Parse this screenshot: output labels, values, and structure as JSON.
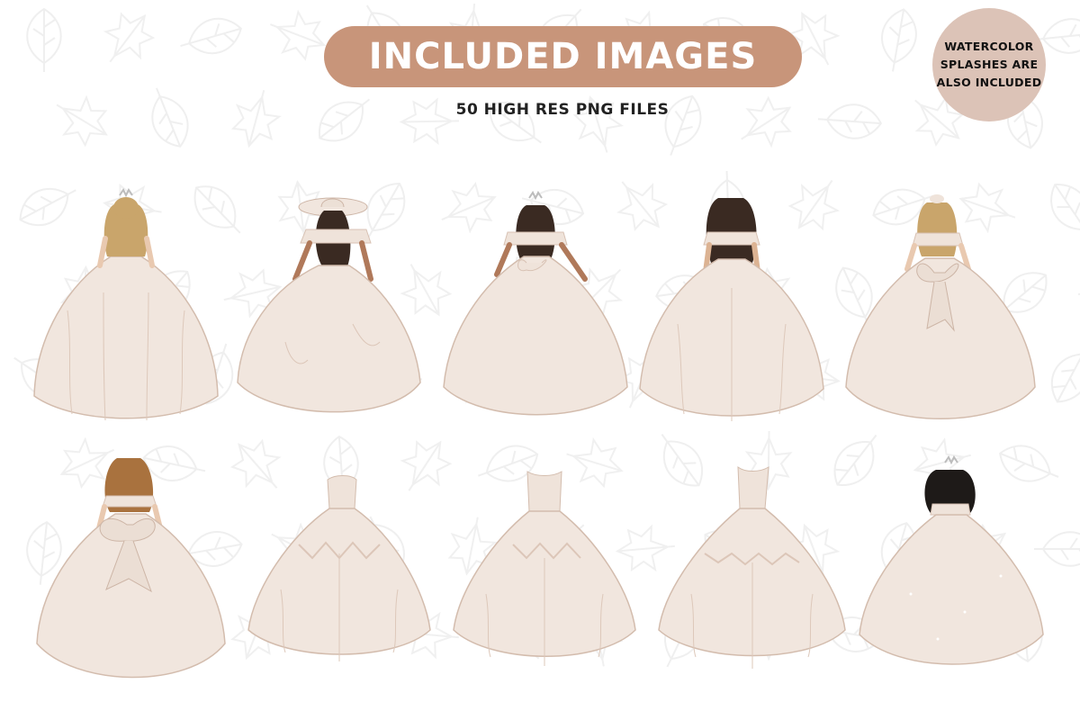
{
  "header": {
    "title": "INCLUDED IMAGES",
    "subtitle": "50 HIGH RES PNG FILES"
  },
  "badge": {
    "lines": [
      "WATERCOLOR",
      "SPLASHES ARE",
      "ALSO INCLUDED"
    ]
  },
  "colors": {
    "title_pill": "#c8957a",
    "badge": "#dcc3b7",
    "gown": "#efe3da",
    "gown_shadow": "#d8c2b4",
    "background_leaves": "#f1f1f1"
  },
  "gallery": {
    "row1": [
      {
        "id": "gown-girl-blonde-tiara",
        "hair": "blonde",
        "accessory": "tiara"
      },
      {
        "id": "gown-girl-wide-hat",
        "hair": "dark-brown",
        "accessory": "hat"
      },
      {
        "id": "gown-girl-brunette-tiara",
        "hair": "dark-brown",
        "accessory": "tiara"
      },
      {
        "id": "gown-girl-brunette",
        "hair": "dark-brown",
        "accessory": "none"
      },
      {
        "id": "gown-girl-blonde-bow",
        "hair": "blonde",
        "accessory": "bow"
      }
    ],
    "row2": [
      {
        "id": "gown-girl-auburn-big-bow",
        "hair": "auburn",
        "accessory": "big-bow"
      },
      {
        "id": "dress-only-lace-1",
        "hair": "none",
        "accessory": "none"
      },
      {
        "id": "dress-only-lace-2",
        "hair": "none",
        "accessory": "none"
      },
      {
        "id": "dress-only-lace-3",
        "hair": "none",
        "accessory": "none"
      },
      {
        "id": "gown-girl-black-curly-tiara",
        "hair": "black",
        "accessory": "tiara"
      }
    ]
  }
}
